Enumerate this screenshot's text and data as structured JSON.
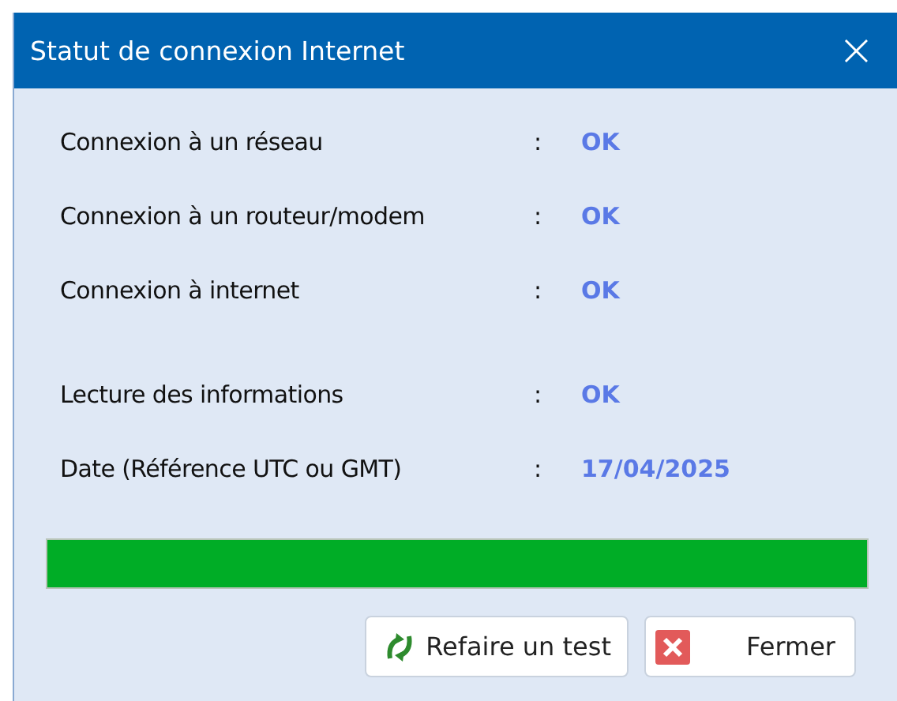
{
  "window": {
    "title": "Statut de connexion Internet",
    "close": "×"
  },
  "sections": [
    {
      "rows": [
        {
          "label": "Connexion à un réseau",
          "separator": ":",
          "value": "OK"
        },
        {
          "label": "Connexion à un routeur/modem",
          "separator": ":",
          "value": "OK"
        },
        {
          "label": "Connexion à internet",
          "separator": ":",
          "value": "OK"
        }
      ]
    },
    {
      "rows": [
        {
          "label": "Lecture des informations",
          "separator": ":",
          "value": "OK"
        },
        {
          "label": "Date (Référence UTC ou GMT)",
          "separator": ":",
          "value": "17/04/2025"
        }
      ]
    }
  ],
  "progress": {
    "level": 1
  },
  "buttons": [
    {
      "label": "Refaire un test",
      "kind": "retry"
    },
    {
      "label": "Fermer",
      "kind": "close"
    }
  ]
}
